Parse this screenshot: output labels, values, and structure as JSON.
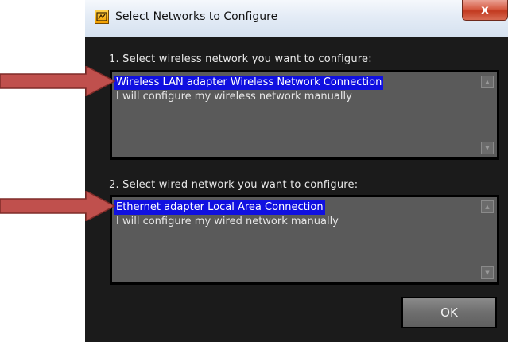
{
  "window": {
    "title": "Select Networks to Configure",
    "close_label": "x"
  },
  "wireless": {
    "label": "1. Select wireless network you want to configure:",
    "items": [
      {
        "label": "Wireless LAN adapter Wireless Network Connection",
        "selected": true
      },
      {
        "label": "I will configure my wireless network manually",
        "selected": false
      }
    ]
  },
  "wired": {
    "label": "2. Select wired network you want to configure:",
    "items": [
      {
        "label": "Ethernet adapter Local Area Connection",
        "selected": true
      },
      {
        "label": "I will configure my wired network manually",
        "selected": false
      }
    ]
  },
  "ok_button": {
    "label": "OK"
  },
  "icons": {
    "app": "labview-app-icon",
    "close": "close-icon",
    "arrow": "red-arrow-annotation-icon",
    "scroll_up": "scroll-up-icon",
    "scroll_down": "scroll-down-icon"
  },
  "colors": {
    "selection": "#1010e0",
    "arrow": "#c0504d",
    "listbox_bg": "#5a5a5a",
    "dialog_bg": "#1b1b1b"
  }
}
